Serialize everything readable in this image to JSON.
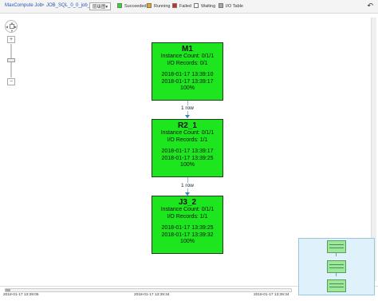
{
  "toolbar": {
    "breadcrumb": [
      {
        "label": "MaxCompute Job"
      },
      {
        "label": "JOB_SQL_0_0_job_0"
      }
    ],
    "separator": ">",
    "layout_button": "层级图▾",
    "back_icon": "undo-icon",
    "legend": [
      {
        "label": "Succeeded",
        "color": "#1ee61e"
      },
      {
        "label": "Running",
        "color": "#f5a20a"
      },
      {
        "label": "Failed",
        "color": "#e0241a"
      },
      {
        "label": "Waiting",
        "color": "#ffffff"
      },
      {
        "label": "I/O Table",
        "color": "#a8a8a8"
      }
    ]
  },
  "zoom": {
    "plus": "+",
    "minus": "−"
  },
  "nodes": [
    {
      "name": "M1",
      "instance": "Instance Count: 0/1/1",
      "io": "I/O Records: 0/1",
      "start": "2018-01-17 13:39:10",
      "end": "2018-01-17 13:39:17",
      "progress": "100%"
    },
    {
      "name": "R2_1",
      "instance": "Instance Count: 0/1/1",
      "io": "I/O Records: 1/1",
      "start": "2018-01-17 13:39:17",
      "end": "2018-01-17 13:39:25",
      "progress": "100%"
    },
    {
      "name": "J3_2",
      "instance": "Instance Count: 0/1/1",
      "io": "I/O Records: 1/1",
      "start": "2018-01-17 13:39:25",
      "end": "2018-01-17 13:39:32",
      "progress": "100%"
    }
  ],
  "edges": [
    {
      "label": "1 row"
    },
    {
      "label": "1 row"
    }
  ],
  "timeline": {
    "labels": [
      "2018-01-17 13:39:06",
      "2018-01-17 13:39:34",
      "2018-01-17 13:39:34"
    ]
  },
  "colors": {
    "succeeded": "#1ee61e",
    "edge": "#3e80b8"
  }
}
